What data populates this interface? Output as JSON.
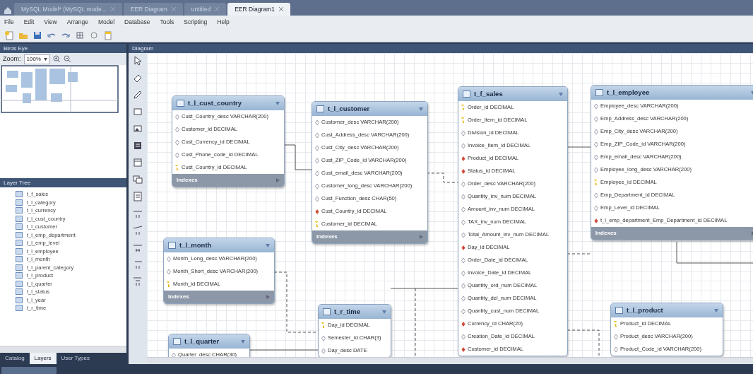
{
  "document_tabs": [
    {
      "label": "MySQL Model* (MySQL mode...",
      "selected": false
    },
    {
      "label": "EER Diagram",
      "selected": false
    },
    {
      "label": "untitled",
      "selected": false
    },
    {
      "label": "EER Diagram1",
      "selected": true
    }
  ],
  "menu": [
    "File",
    "Edit",
    "View",
    "Arrange",
    "Model",
    "Database",
    "Tools",
    "Scripting",
    "Help"
  ],
  "birds_eye": {
    "title": "Birds Eye",
    "zoom_label": "Zoom:",
    "zoom_value": "100%"
  },
  "layer_tree": {
    "title": "Layer Tree",
    "items": [
      "t_f_sales",
      "t_l_category",
      "t_l_currency",
      "t_l_cust_country",
      "t_l_customer",
      "t_l_emp_department",
      "t_l_emp_level",
      "t_l_employee",
      "t_l_month",
      "t_l_parent_category",
      "t_l_product",
      "t_l_quarter",
      "t_l_status",
      "t_l_year",
      "t_r_time"
    ]
  },
  "side_tabs": [
    {
      "label": "Catalog",
      "selected": false
    },
    {
      "label": "Layers",
      "selected": true
    },
    {
      "label": "User Types",
      "selected": false
    }
  ],
  "diagram": {
    "title": "Diagram",
    "tables": [
      {
        "name": "t_l_cust_country",
        "footer": "Indexes",
        "columns": [
          {
            "text": "Cust_Country_desc VARCHAR(200)",
            "kind": "plain"
          },
          {
            "text": "Customer_id DECIMAL",
            "kind": "plain"
          },
          {
            "text": "Cust_Currency_id DECIMAL",
            "kind": "plain"
          },
          {
            "text": "Cust_Phone_code_id DECIMAL",
            "kind": "plain"
          },
          {
            "text": "Cust_Country_id DECIMAL",
            "kind": "pk"
          }
        ]
      },
      {
        "name": "t_l_customer",
        "footer": "Indexes",
        "columns": [
          {
            "text": "Customer_desc VARCHAR(200)",
            "kind": "plain"
          },
          {
            "text": "Cust_Address_desc VARCHAR(200)",
            "kind": "plain"
          },
          {
            "text": "Cust_City_desc VARCHAR(200)",
            "kind": "plain"
          },
          {
            "text": "Cust_ZIP_Code_id VARCHAR(200)",
            "kind": "plain"
          },
          {
            "text": "Cust_email_desc VARCHAR(200)",
            "kind": "plain"
          },
          {
            "text": "Customer_long_desc VARCHAR(200)",
            "kind": "plain"
          },
          {
            "text": "Cust_Function_desc CHAR(50)",
            "kind": "plain"
          },
          {
            "text": "Cust_Country_id DECIMAL",
            "kind": "fk"
          },
          {
            "text": "Customer_id DECIMAL",
            "kind": "pk"
          }
        ]
      },
      {
        "name": "t_f_sales",
        "columns": [
          {
            "text": "Order_id DECIMAL",
            "kind": "pk"
          },
          {
            "text": "Order_Item_id DECIMAL",
            "kind": "pk"
          },
          {
            "text": "Division_id DECIMAL",
            "kind": "plain"
          },
          {
            "text": "Invoice_Item_id DECIMAL",
            "kind": "plain"
          },
          {
            "text": "Product_id DECIMAL",
            "kind": "fk"
          },
          {
            "text": "Status_id DECIMAL",
            "kind": "fk"
          },
          {
            "text": "Order_desc VARCHAR(200)",
            "kind": "plain"
          },
          {
            "text": "Quantity_inv_num DECIMAL",
            "kind": "plain"
          },
          {
            "text": "Amount_inv_num DECIMAL",
            "kind": "plain"
          },
          {
            "text": "TAX_inv_num DECIMAL",
            "kind": "plain"
          },
          {
            "text": "Total_Amount_inv_num DECIMAL",
            "kind": "plain"
          },
          {
            "text": "Day_id DECIMAL",
            "kind": "fk"
          },
          {
            "text": "Order_Date_id DECIMAL",
            "kind": "plain"
          },
          {
            "text": "Invoice_Date_id DECIMAL",
            "kind": "plain"
          },
          {
            "text": "Quantity_ord_num DECIMAL",
            "kind": "plain"
          },
          {
            "text": "Quantity_del_num DECIMAL",
            "kind": "plain"
          },
          {
            "text": "Quantity_cust_num DECIMAL",
            "kind": "plain"
          },
          {
            "text": "Currency_id CHAR(20)",
            "kind": "fk"
          },
          {
            "text": "Creation_Date_id DECIMAL",
            "kind": "plain"
          },
          {
            "text": "Customer_id DECIMAL",
            "kind": "fk"
          }
        ]
      },
      {
        "name": "t_l_employee",
        "footer": "Indexes",
        "columns": [
          {
            "text": "Employee_desc VARCHAR(200)",
            "kind": "plain"
          },
          {
            "text": "Emp_Address_desc VARCHAR(200)",
            "kind": "plain"
          },
          {
            "text": "Emp_City_desc VARCHAR(200)",
            "kind": "plain"
          },
          {
            "text": "Emp_ZIP_Code_id VARCHAR(200)",
            "kind": "plain"
          },
          {
            "text": "Emp_email_desc VARCHAR(200)",
            "kind": "plain"
          },
          {
            "text": "Employee_long_desc VARCHAR(200)",
            "kind": "plain"
          },
          {
            "text": "Employee_id DECIMAL",
            "kind": "pk"
          },
          {
            "text": "Emp_Department_id DECIMAL",
            "kind": "plain"
          },
          {
            "text": "Emp_Level_id DECIMAL",
            "kind": "plain"
          },
          {
            "text": "t_l_emp_department_Emp_Department_id DECIMAL",
            "kind": "fk"
          }
        ]
      },
      {
        "name": "t_l_month",
        "footer": "Indexes",
        "columns": [
          {
            "text": "Month_Long_desc VARCHAR(200)",
            "kind": "plain"
          },
          {
            "text": "Month_Short_desc VARCHAR(200)",
            "kind": "plain"
          },
          {
            "text": "Month_id DECIMAL",
            "kind": "pk"
          }
        ]
      },
      {
        "name": "t_r_time",
        "columns": [
          {
            "text": "Day_id DECIMAL",
            "kind": "pk"
          },
          {
            "text": "Semester_id CHAR(3)",
            "kind": "plain"
          },
          {
            "text": "Day_desc DATE",
            "kind": "plain"
          }
        ]
      },
      {
        "name": "t_l_quarter",
        "columns": [
          {
            "text": "Quarter_desc CHAR(30)",
            "kind": "plain"
          }
        ]
      },
      {
        "name": "t_l_product",
        "columns": [
          {
            "text": "Product_id DECIMAL",
            "kind": "pk"
          },
          {
            "text": "Product_desc VARCHAR(200)",
            "kind": "plain"
          },
          {
            "text": "Product_Code_id VARCHAR(200)",
            "kind": "plain"
          }
        ]
      }
    ]
  }
}
